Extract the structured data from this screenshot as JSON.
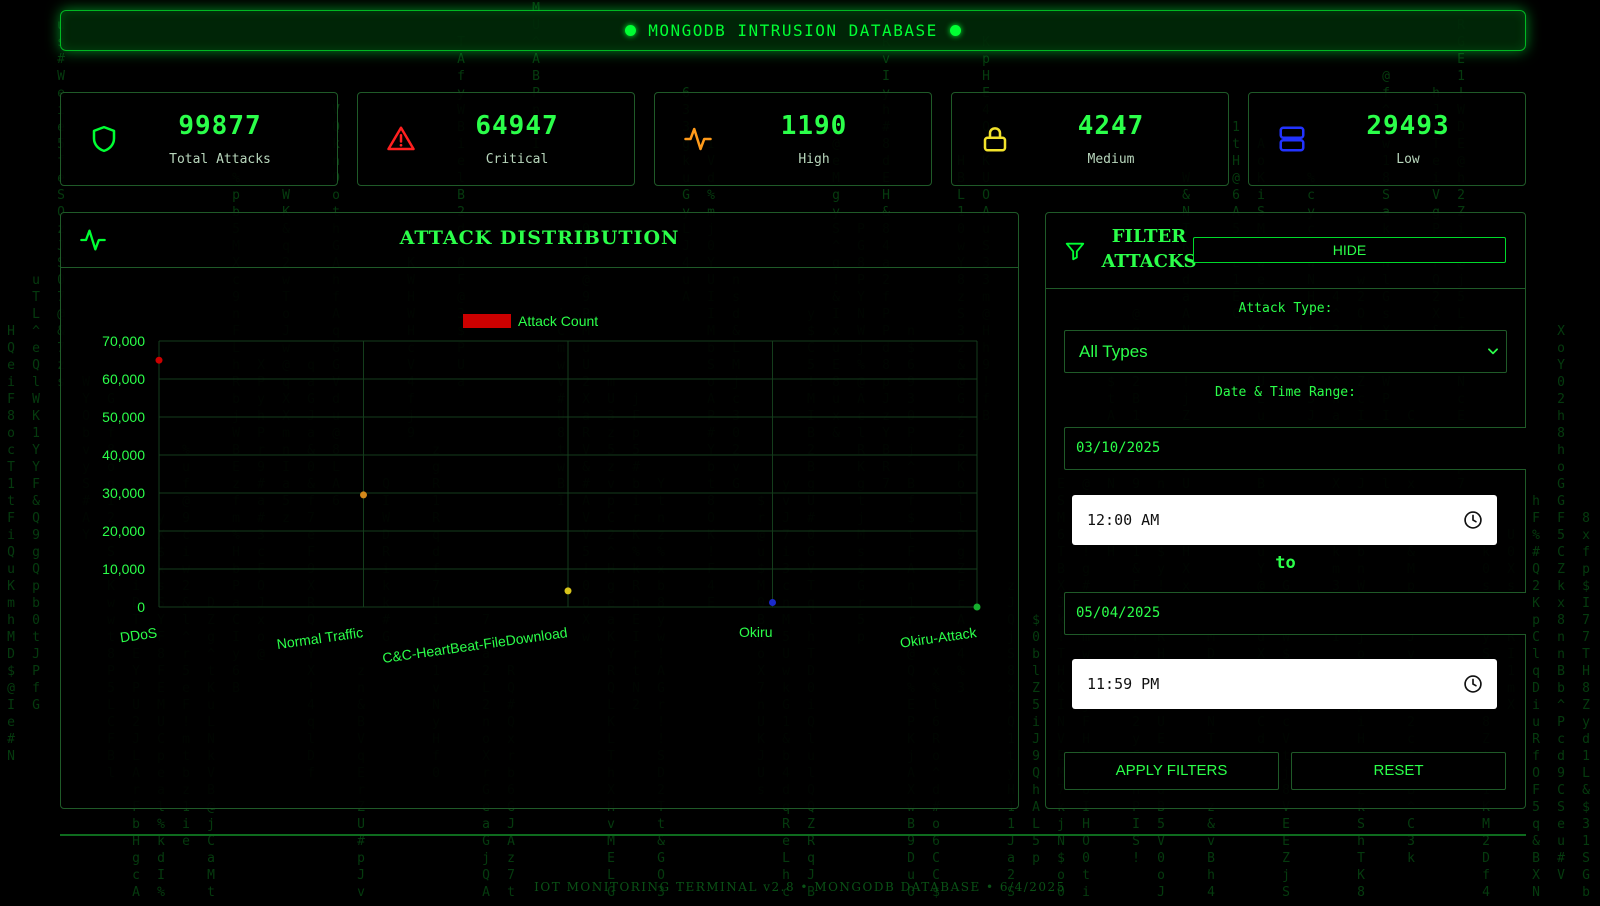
{
  "header": {
    "title": "MONGODB INTRUSION DATABASE"
  },
  "stats": [
    {
      "value": "99877",
      "label": "Total Attacks",
      "icon": "shield-icon",
      "color": "#00ff33"
    },
    {
      "value": "64947",
      "label": "Critical",
      "icon": "alert-triangle-icon",
      "color": "#ff2020"
    },
    {
      "value": "1190",
      "label": "High",
      "icon": "activity-icon",
      "color": "#ff9a1a"
    },
    {
      "value": "4247",
      "label": "Medium",
      "icon": "lock-icon",
      "color": "#f2e22b"
    },
    {
      "value": "29493",
      "label": "Low",
      "icon": "server-icon",
      "color": "#2233ff"
    }
  ],
  "chart_panel": {
    "title": "ATTACK DISTRIBUTION",
    "icon": "activity-icon"
  },
  "chart_data": {
    "type": "scatter",
    "categories": [
      "DDoS",
      "Normal Traffic",
      "C&C-HeartBeat-FileDownload",
      "Okiru",
      "Okiru-Attack"
    ],
    "series": [
      {
        "name": "Attack Count",
        "values": [
          64947,
          29493,
          4247,
          1190,
          0
        ]
      }
    ],
    "point_colors": [
      "#cc0000",
      "#d4881a",
      "#d8c41a",
      "#1a2acc",
      "#16b02e"
    ],
    "legend_color": "#cc0000",
    "yticks": [
      "70,000",
      "60,000",
      "50,000",
      "40,000",
      "30,000",
      "20,000",
      "10,000",
      "0"
    ],
    "ylim": [
      0,
      70000
    ],
    "grid": true,
    "legend_position": "top-center"
  },
  "filter": {
    "title_line1": "FILTER",
    "title_line2": "ATTACKS",
    "hide_label": "HIDE",
    "attack_type_label": "Attack Type:",
    "attack_type_value": "All Types",
    "range_label": "Date & Time Range:",
    "start_date": "03/10/2025",
    "start_time": "12:00 AM",
    "to_label": "to",
    "end_date": "05/04/2025",
    "end_time": "11:59 PM",
    "apply_label": "APPLY FILTERS",
    "reset_label": "RESET"
  },
  "footer": {
    "text": "IOT MONITORING TERMINAL v2.8 • MONGODB DATABASE • 6/4/2025"
  },
  "theme": {
    "accent": "#00ff33",
    "panel_border": "#1f5a28",
    "rain": "#0a6b1a"
  }
}
